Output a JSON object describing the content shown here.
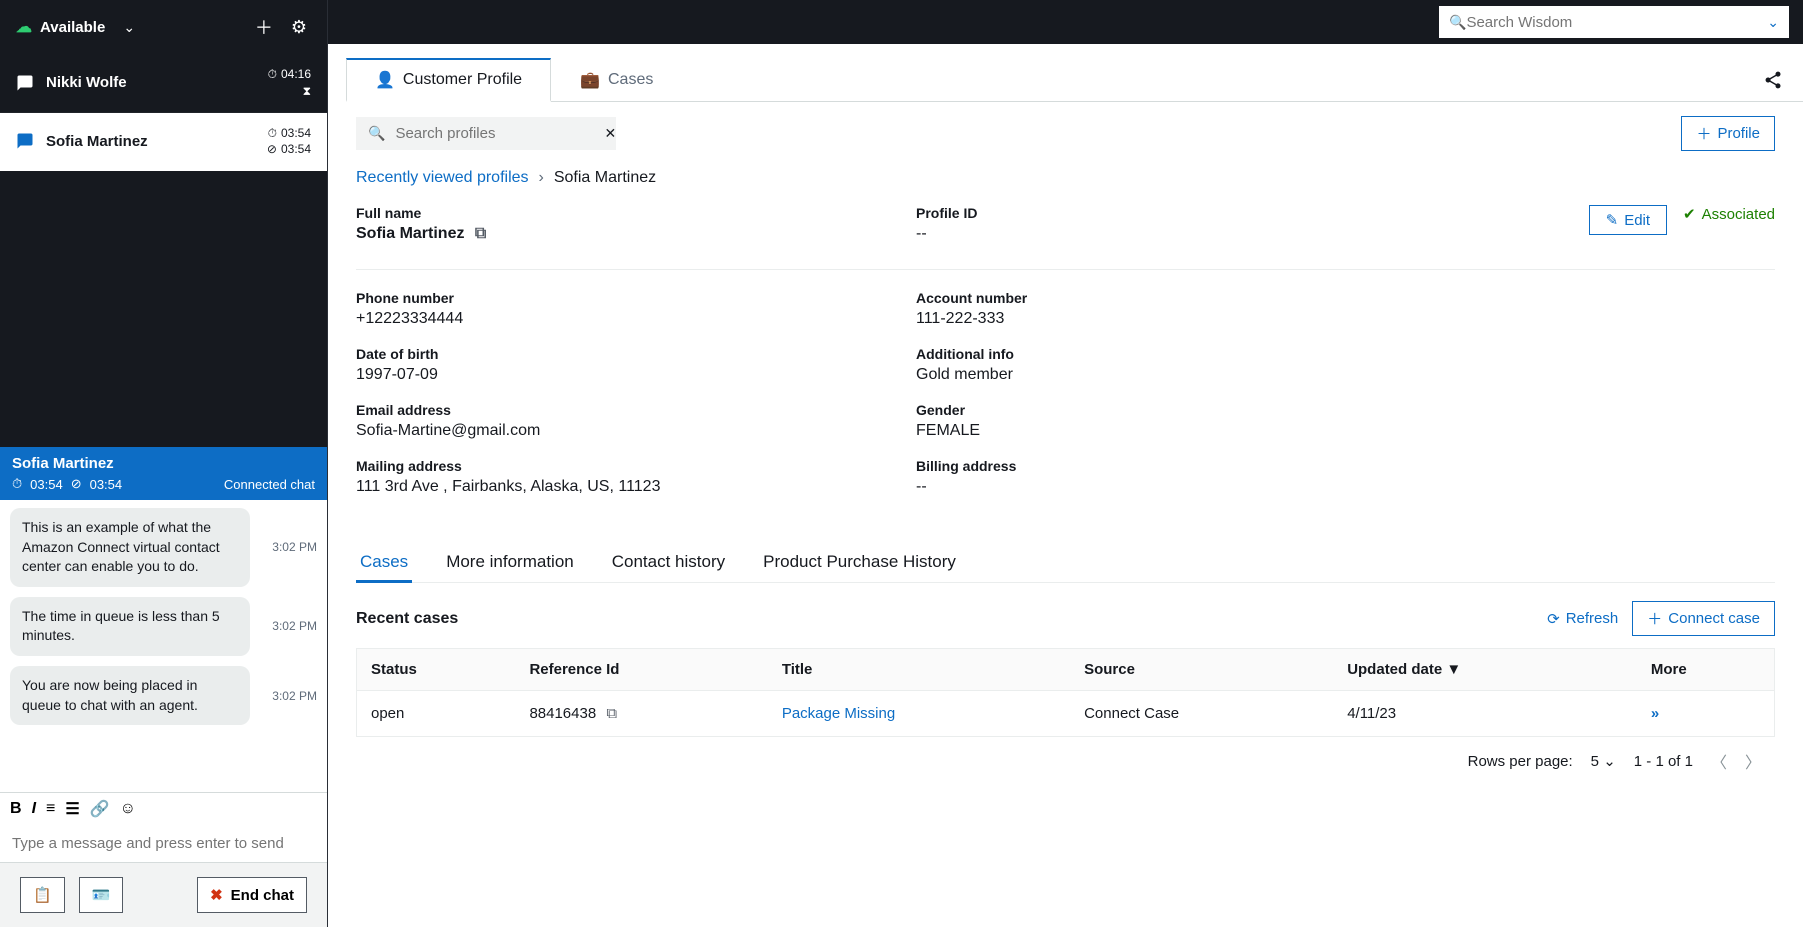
{
  "status": {
    "label": "Available"
  },
  "contacts": [
    {
      "name": "Nikki Wolfe",
      "time1": "04:16",
      "active": false
    },
    {
      "name": "Sofia Martinez",
      "time1": "03:54",
      "time2": "03:54",
      "active": true
    }
  ],
  "chat_header": {
    "name": "Sofia Martinez",
    "t1": "03:54",
    "t2": "03:54",
    "status": "Connected chat"
  },
  "messages": [
    {
      "text": "This is an example of what the Amazon Connect virtual contact center can enable you to do.",
      "time": "3:02 PM"
    },
    {
      "text": "The time in queue is less than 5 minutes.",
      "time": "3:02 PM"
    },
    {
      "text": "You are now being placed in queue to chat with an agent.",
      "time": "3:02 PM"
    }
  ],
  "chat_input_placeholder": "Type a message and press enter to send",
  "end_chat_label": "End chat",
  "search_wisdom_placeholder": "Search Wisdom",
  "tabs": {
    "customer_profile": "Customer Profile",
    "cases": "Cases"
  },
  "search_profiles_placeholder": "Search profiles",
  "add_profile_label": "Profile",
  "breadcrumb": {
    "root": "Recently viewed profiles",
    "current": "Sofia Martinez"
  },
  "edit_label": "Edit",
  "associated_label": "Associated",
  "profile": {
    "full_name_label": "Full name",
    "full_name": "Sofia Martinez",
    "profile_id_label": "Profile ID",
    "profile_id": "--",
    "phone_label": "Phone number",
    "phone": "+12223334444",
    "account_label": "Account number",
    "account": "111-222-333",
    "dob_label": "Date of birth",
    "dob": "1997-07-09",
    "addl_label": "Additional info",
    "addl": "Gold member",
    "email_label": "Email address",
    "email": "Sofia-Martine@gmail.com",
    "gender_label": "Gender",
    "gender": "FEMALE",
    "mailing_label": "Mailing address",
    "mailing": "111 3rd Ave , Fairbanks, Alaska, US, 11123",
    "billing_label": "Billing address",
    "billing": "--"
  },
  "subtabs": {
    "cases": "Cases",
    "more_info": "More information",
    "contact_history": "Contact history",
    "purchase": "Product Purchase History"
  },
  "recent_cases_label": "Recent cases",
  "refresh_label": "Refresh",
  "connect_case_label": "Connect case",
  "table": {
    "headers": {
      "status": "Status",
      "ref": "Reference Id",
      "title": "Title",
      "source": "Source",
      "updated": "Updated date",
      "more": "More"
    },
    "rows": [
      {
        "status": "open",
        "ref": "88416438",
        "title": "Package Missing",
        "source": "Connect Case",
        "updated": "4/11/23"
      }
    ]
  },
  "pagination": {
    "rows_label": "Rows per page:",
    "rows_value": "5",
    "range": "1 - 1 of 1"
  }
}
